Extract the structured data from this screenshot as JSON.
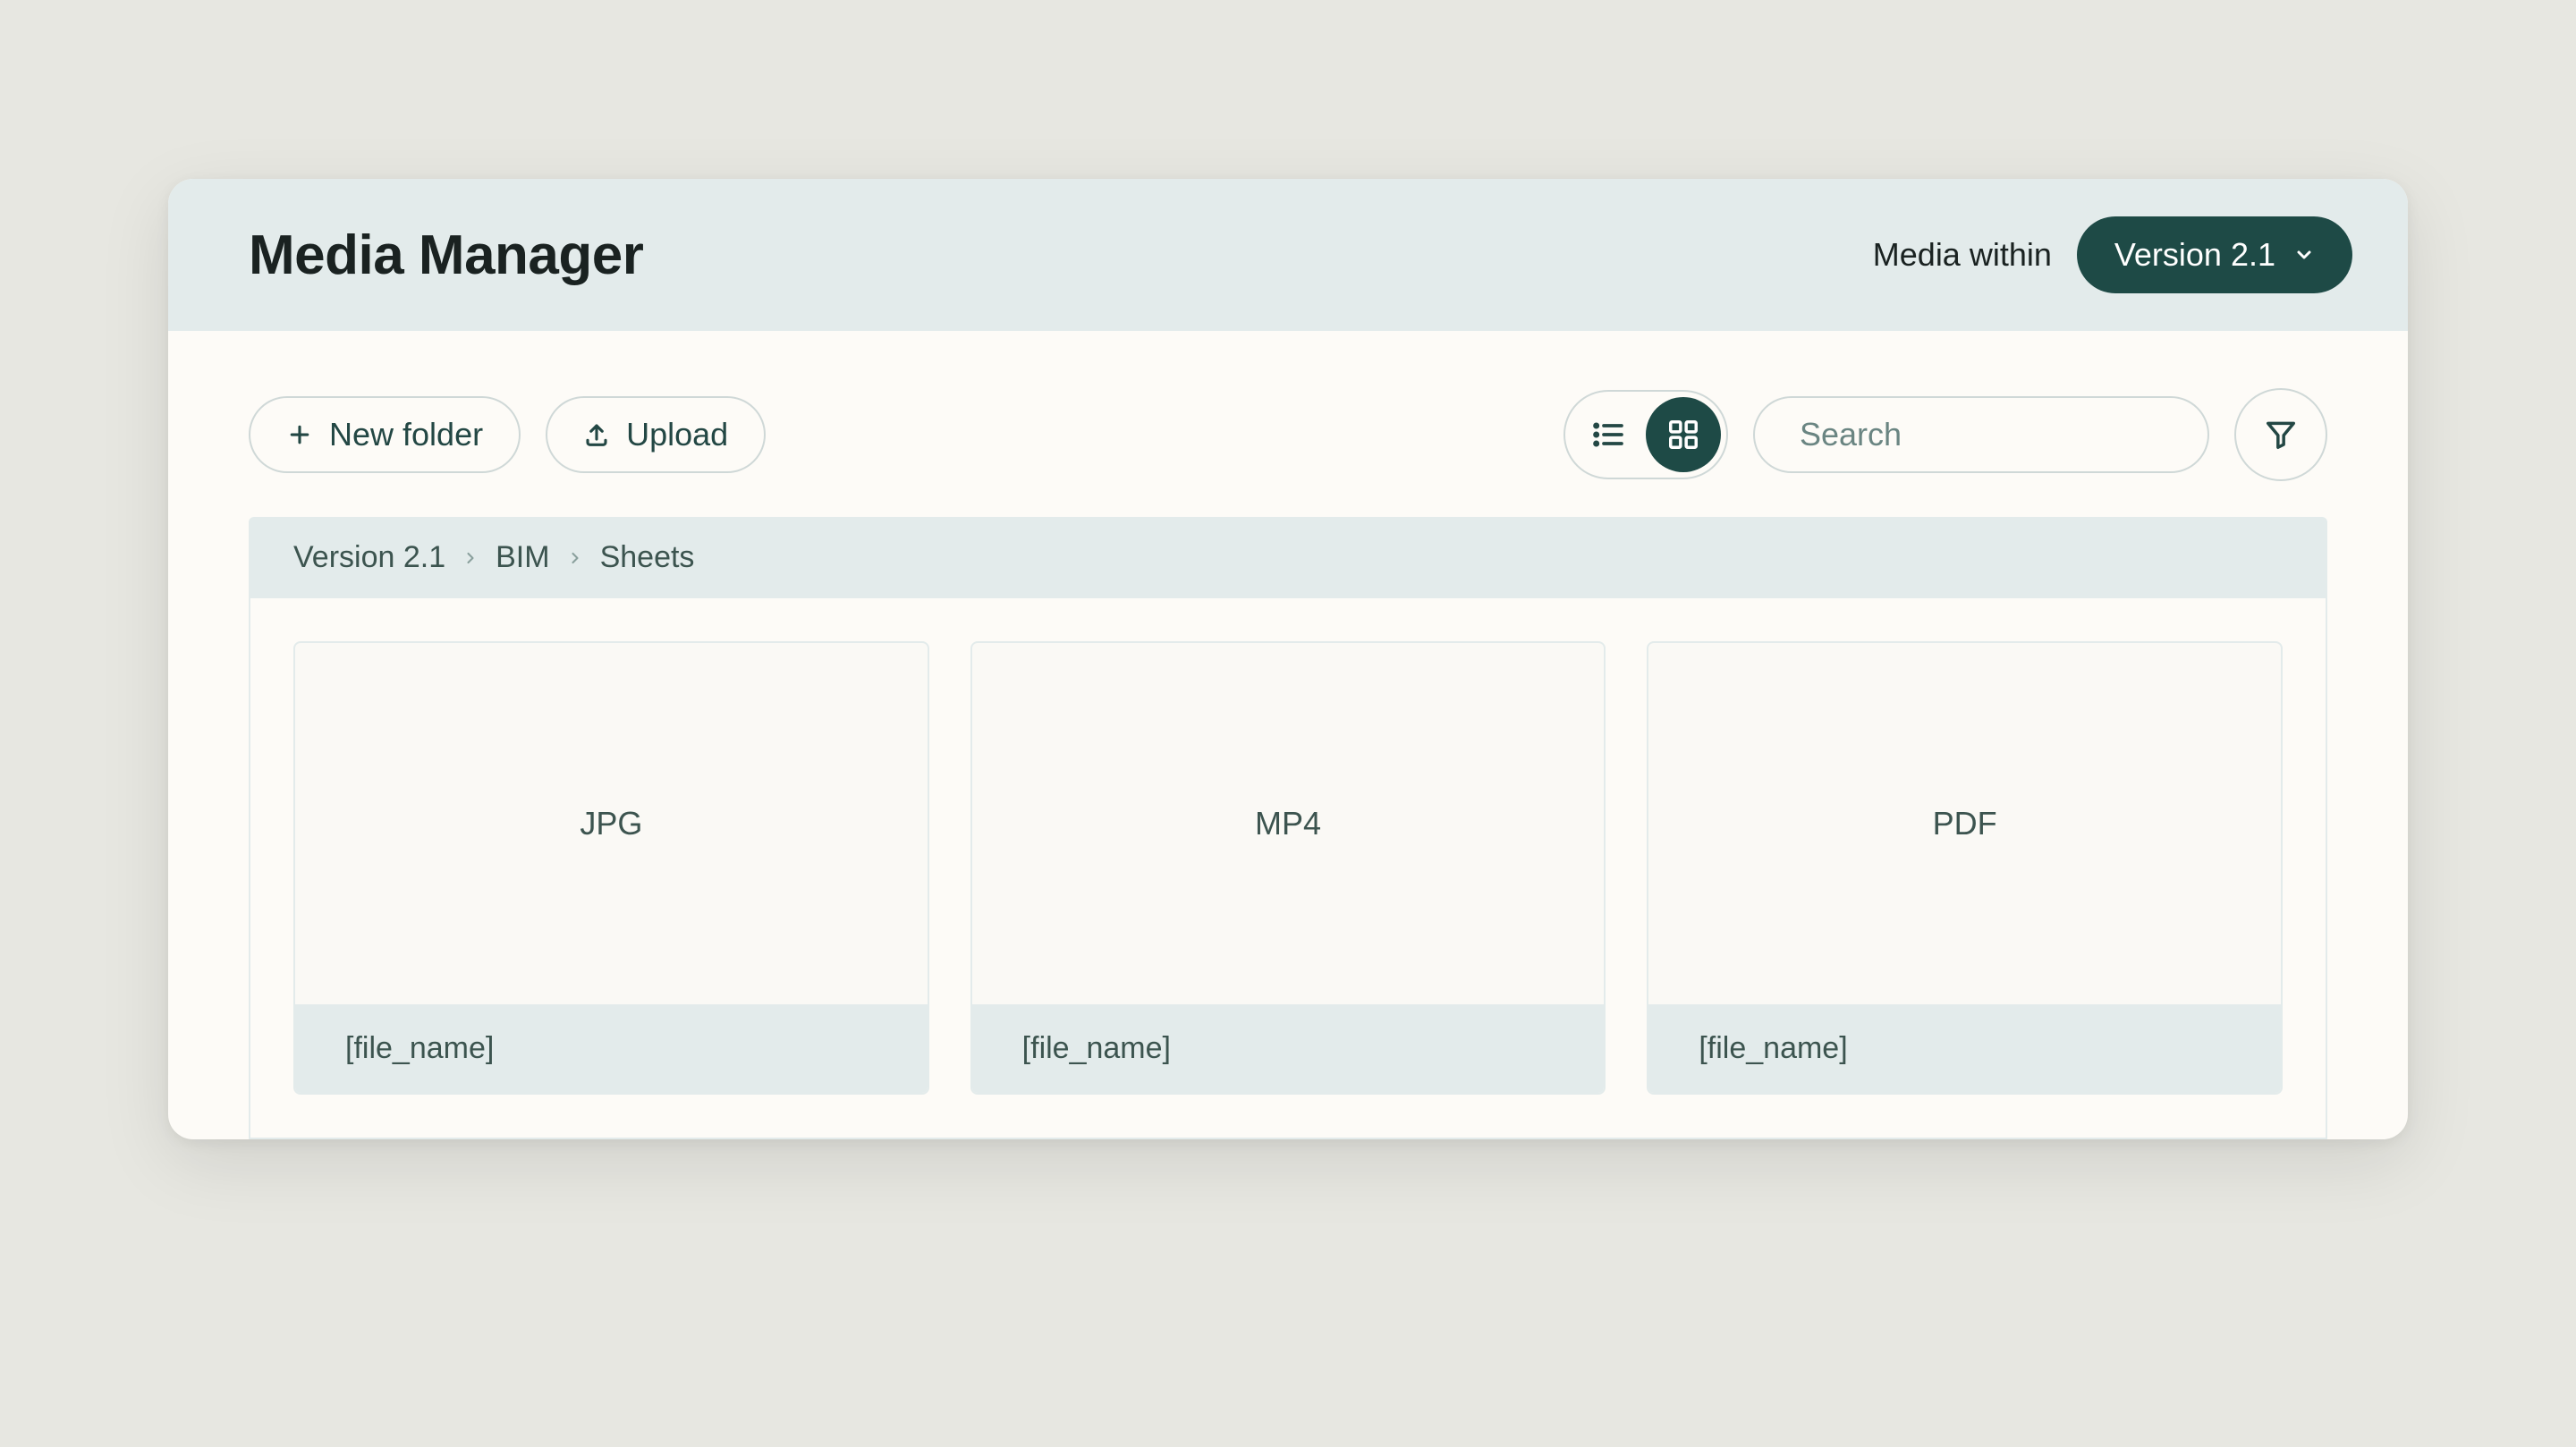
{
  "header": {
    "title": "Media Manager",
    "scope_label": "Media within",
    "version_label": "Version 2.1"
  },
  "toolbar": {
    "new_folder_label": "New folder",
    "upload_label": "Upload",
    "search_placeholder": "Search",
    "view_mode": "grid"
  },
  "breadcrumb": [
    "Version 2.1",
    "BIM",
    "Sheets"
  ],
  "files": [
    {
      "type": "JPG",
      "name": "[file_name]"
    },
    {
      "type": "MP4",
      "name": "[file_name]"
    },
    {
      "type": "PDF",
      "name": "[file_name]"
    }
  ],
  "colors": {
    "accent": "#1e4a46",
    "header_bg": "#e3ebeb",
    "page_bg": "#e7e7e1",
    "panel_bg": "#fdfbf7"
  }
}
